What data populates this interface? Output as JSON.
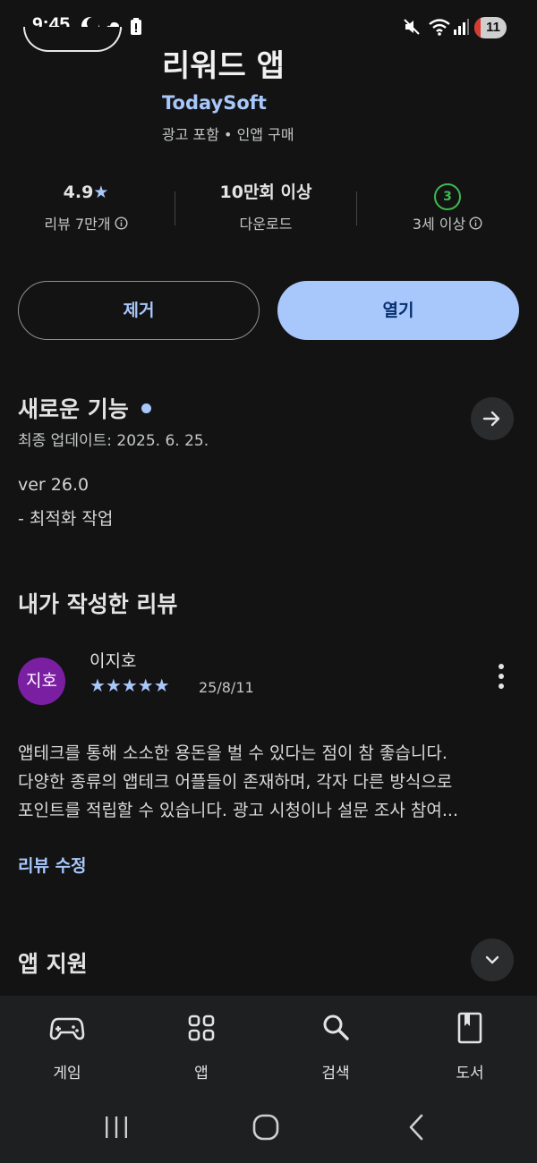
{
  "status_bar": {
    "time": "9:45",
    "battery_level": "11",
    "icons": [
      "moon-icon",
      "cloud-icon",
      "alert-icon",
      "mute-icon",
      "wifi-icon",
      "signal-icon"
    ]
  },
  "app": {
    "title": "리워드 앱",
    "developer": "TodaySoft",
    "meta": "광고 포함 • 인앱 구매"
  },
  "stats": {
    "rating": "4.9",
    "reviews": "리뷰 7만개",
    "downloads": "10만회 이상",
    "downloads_label": "다운로드",
    "age_badge": "3",
    "age_label": "3세 이상"
  },
  "buttons": {
    "remove": "제거",
    "open": "열기"
  },
  "whats_new": {
    "title": "새로운 기능",
    "updated": "최종 업데이트: 2025. 6. 25.",
    "version": "ver 26.0",
    "notes": "- 최적화 작업"
  },
  "my_review": {
    "title": "내가 작성한 리뷰",
    "avatar_text": "지호",
    "reviewer": "이지호",
    "stars": "★★★★★",
    "rating": 5,
    "date": "25/8/11",
    "lines": [
      "앱테크를 통해 소소한 용돈을 벌 수 있다는 점이 참 좋습니다.",
      "다양한 종류의 앱테크 어플들이 존재하며, 각자 다른 방식으로",
      "포인트를 적립할 수 있습니다. 광고 시청이나 설문 조사 참여..."
    ],
    "edit_link": "리뷰 수정"
  },
  "app_support": {
    "title": "앱 지원"
  },
  "bottom_nav": [
    {
      "label": "게임",
      "icon": "gamepad-icon"
    },
    {
      "label": "앱",
      "icon": "apps-grid-icon"
    },
    {
      "label": "검색",
      "icon": "search-icon"
    },
    {
      "label": "도서",
      "icon": "book-icon"
    }
  ],
  "colors": {
    "background": "#131314",
    "accent": "#a8c7fa",
    "age_badge": "#3dba4e",
    "avatar": "#7b1fa2"
  }
}
